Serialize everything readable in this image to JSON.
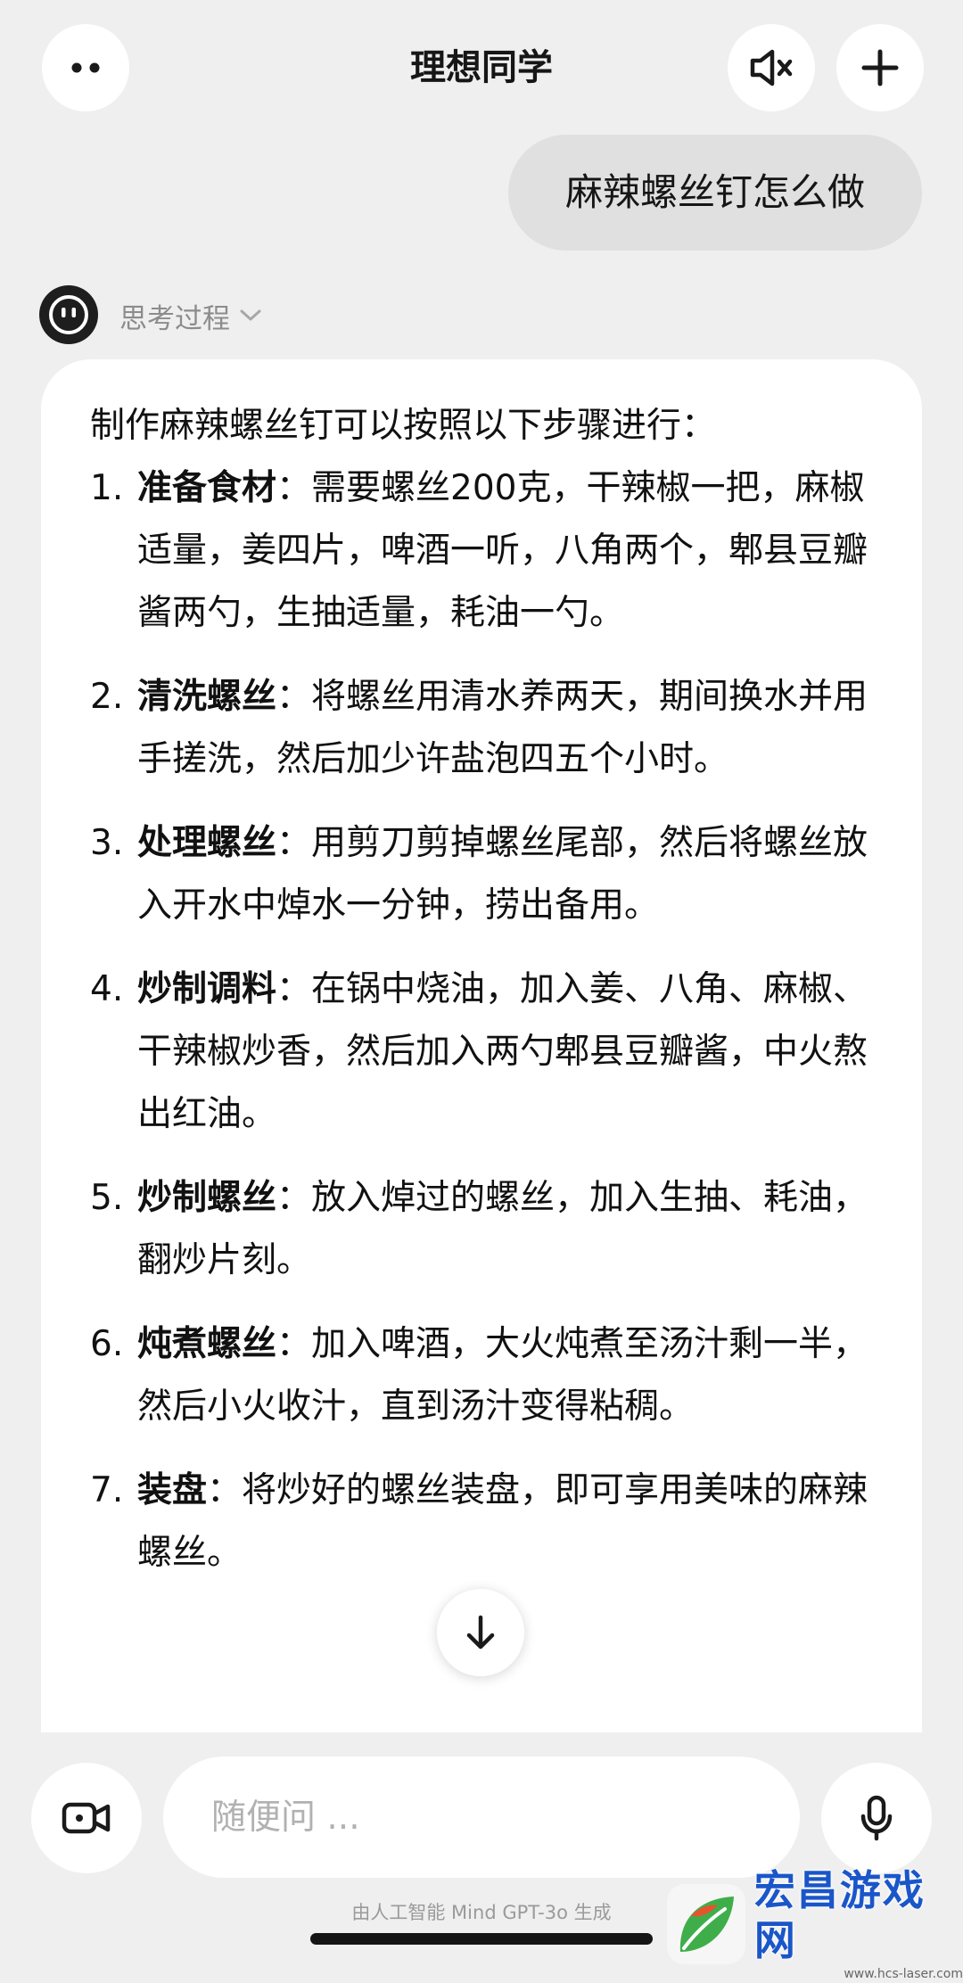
{
  "header": {
    "title": "理想同学",
    "menu_icon": "two-dots-icon",
    "mute_icon": "speaker-muted-icon",
    "new_icon": "plus-icon"
  },
  "user_message": "麻辣螺丝钉怎么做",
  "assistant": {
    "avatar_icon": "robot-face-icon",
    "thinking_label": "思考过程",
    "intro": "制作麻辣螺丝钉可以按照以下步骤进行：",
    "steps": [
      {
        "num": "1.",
        "head": "准备食材",
        "body": "：需要螺丝200克，干辣椒一把，麻椒适量，姜四片，啤酒一听，八角两个，郫县豆瓣酱两勺，生抽适量，耗油一勺。"
      },
      {
        "num": "2.",
        "head": "清洗螺丝",
        "body": "：将螺丝用清水养两天，期间换水并用手搓洗，然后加少许盐泡四五个小时。"
      },
      {
        "num": "3.",
        "head": "处理螺丝",
        "body": "：用剪刀剪掉螺丝尾部，然后将螺丝放入开水中焯水一分钟，捞出备用。"
      },
      {
        "num": "4.",
        "head": "炒制调料",
        "body": "：在锅中烧油，加入姜、八角、麻椒、干辣椒炒香，然后加入两勺郫县豆瓣酱，中火熬出红油。"
      },
      {
        "num": "5.",
        "head": "炒制螺丝",
        "body": "：放入焯过的螺丝，加入生抽、耗油，翻炒片刻。"
      },
      {
        "num": "6.",
        "head": "炖煮螺丝",
        "body": "：加入啤酒，大火炖煮至汤汁剩一半，然后小火收汁，直到汤汁变得粘稠。"
      },
      {
        "num": "7.",
        "head": "装盘",
        "body": "：将炒好的螺丝装盘，即可享用美味的麻辣螺丝。"
      }
    ]
  },
  "input": {
    "placeholder": "随便问 ...",
    "value": "",
    "video_icon": "video-camera-icon",
    "mic_icon": "microphone-icon"
  },
  "footer_note": "由人工智能 Mind GPT-3o 生成",
  "watermark": {
    "title": "宏昌游戏网",
    "url": "www.hcs-laser.com"
  },
  "colors": {
    "background": "#efefef",
    "card": "#ffffff",
    "user_bubble": "#e0e0e0",
    "placeholder": "#b1b1b1",
    "watermark_blue": "#1a56c9"
  }
}
